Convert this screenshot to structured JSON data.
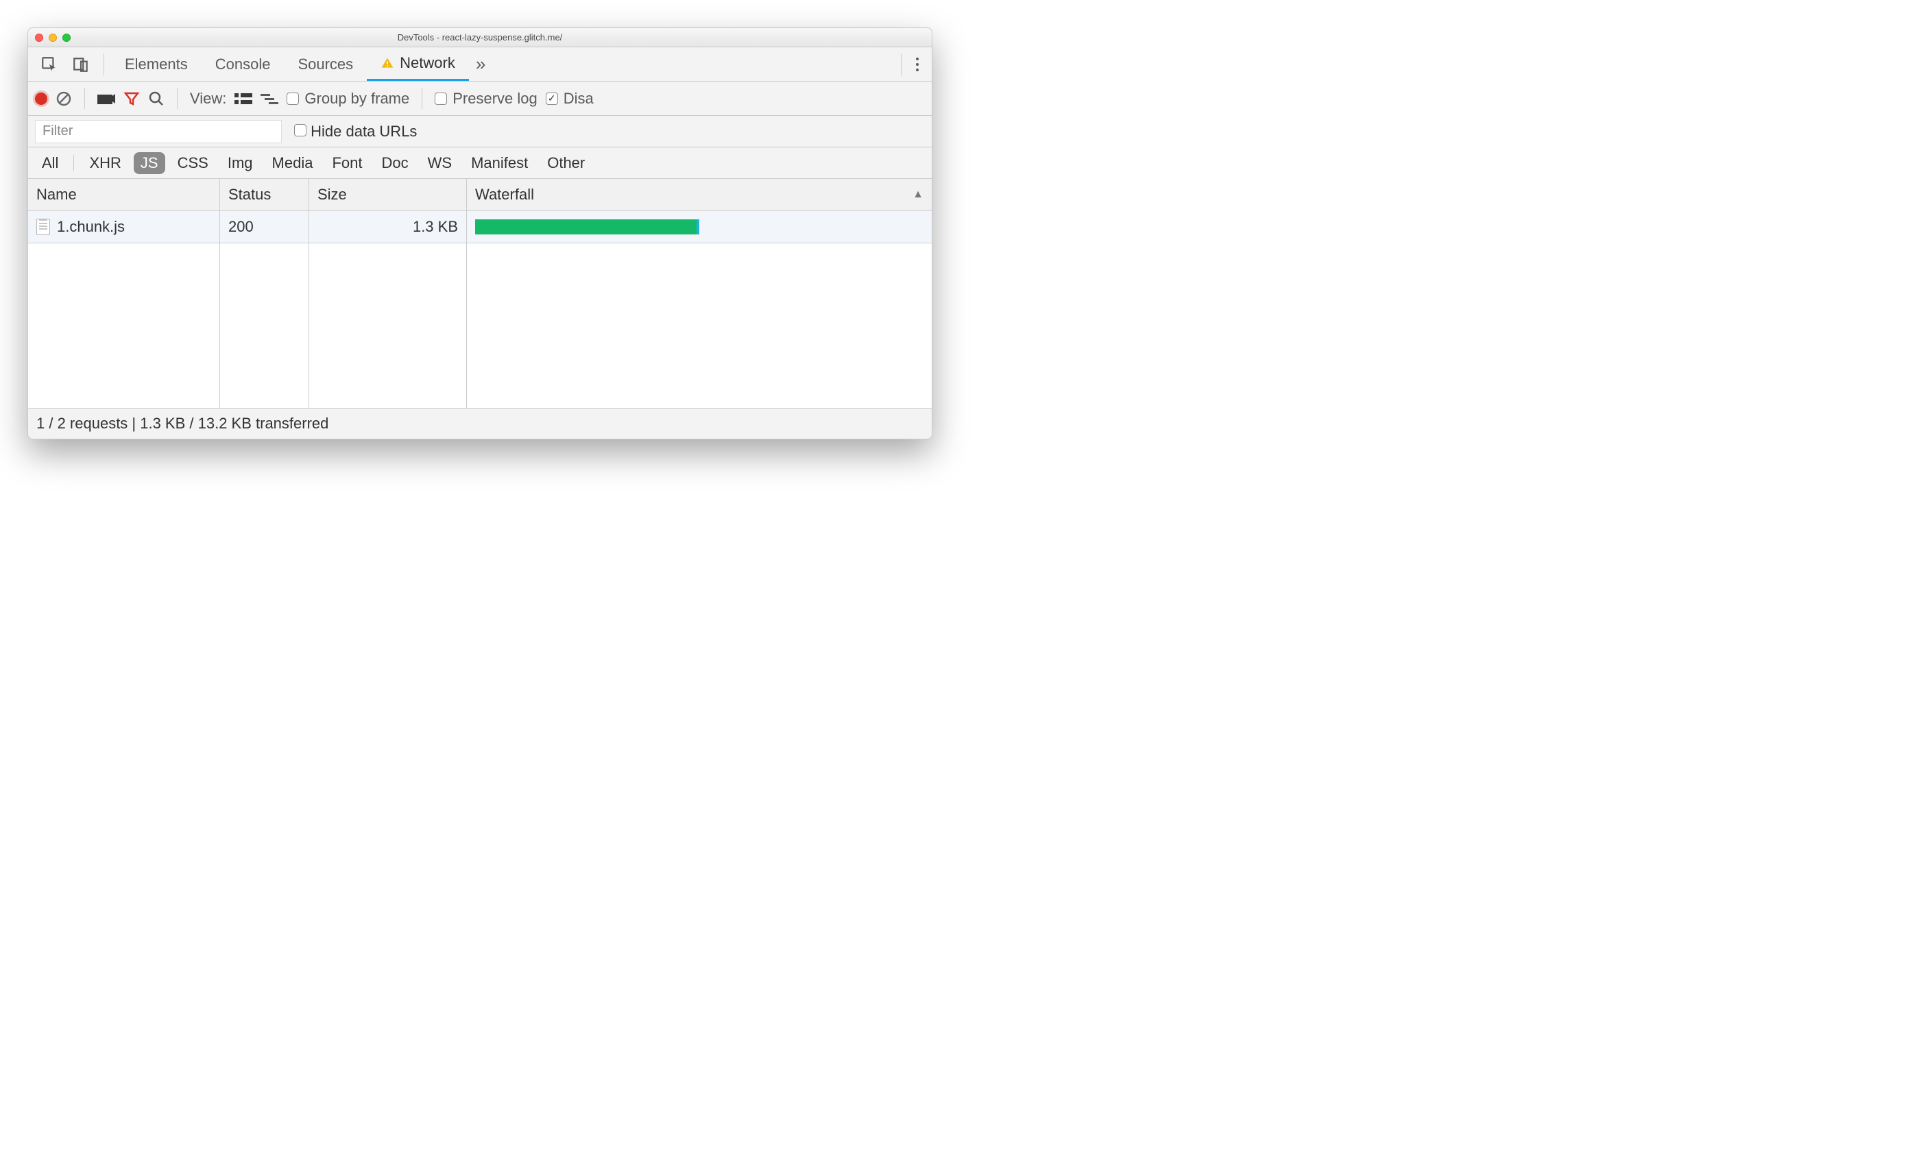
{
  "window": {
    "title": "DevTools - react-lazy-suspense.glitch.me/"
  },
  "tabs": {
    "items": [
      "Elements",
      "Console",
      "Sources",
      "Network"
    ],
    "active": "Network",
    "has_warning_on_active": true
  },
  "toolbar": {
    "view_label": "View:",
    "group_by_frame": "Group by frame",
    "preserve_log": "Preserve log",
    "disable_cache": "Disa",
    "preserve_log_checked": false,
    "disable_cache_checked": true,
    "group_by_frame_checked": false
  },
  "filter": {
    "placeholder": "Filter",
    "hide_data_urls": "Hide data URLs",
    "hide_data_urls_checked": false
  },
  "types": {
    "items": [
      "All",
      "XHR",
      "JS",
      "CSS",
      "Img",
      "Media",
      "Font",
      "Doc",
      "WS",
      "Manifest",
      "Other"
    ],
    "active": "JS"
  },
  "table": {
    "headers": {
      "name": "Name",
      "status": "Status",
      "size": "Size",
      "waterfall": "Waterfall"
    },
    "rows": [
      {
        "name": "1.chunk.js",
        "status": "200",
        "size": "1.3 KB",
        "waterfall_pct": 50
      }
    ]
  },
  "status": {
    "text": "1 / 2 requests | 1.3 KB / 13.2 KB transferred"
  }
}
